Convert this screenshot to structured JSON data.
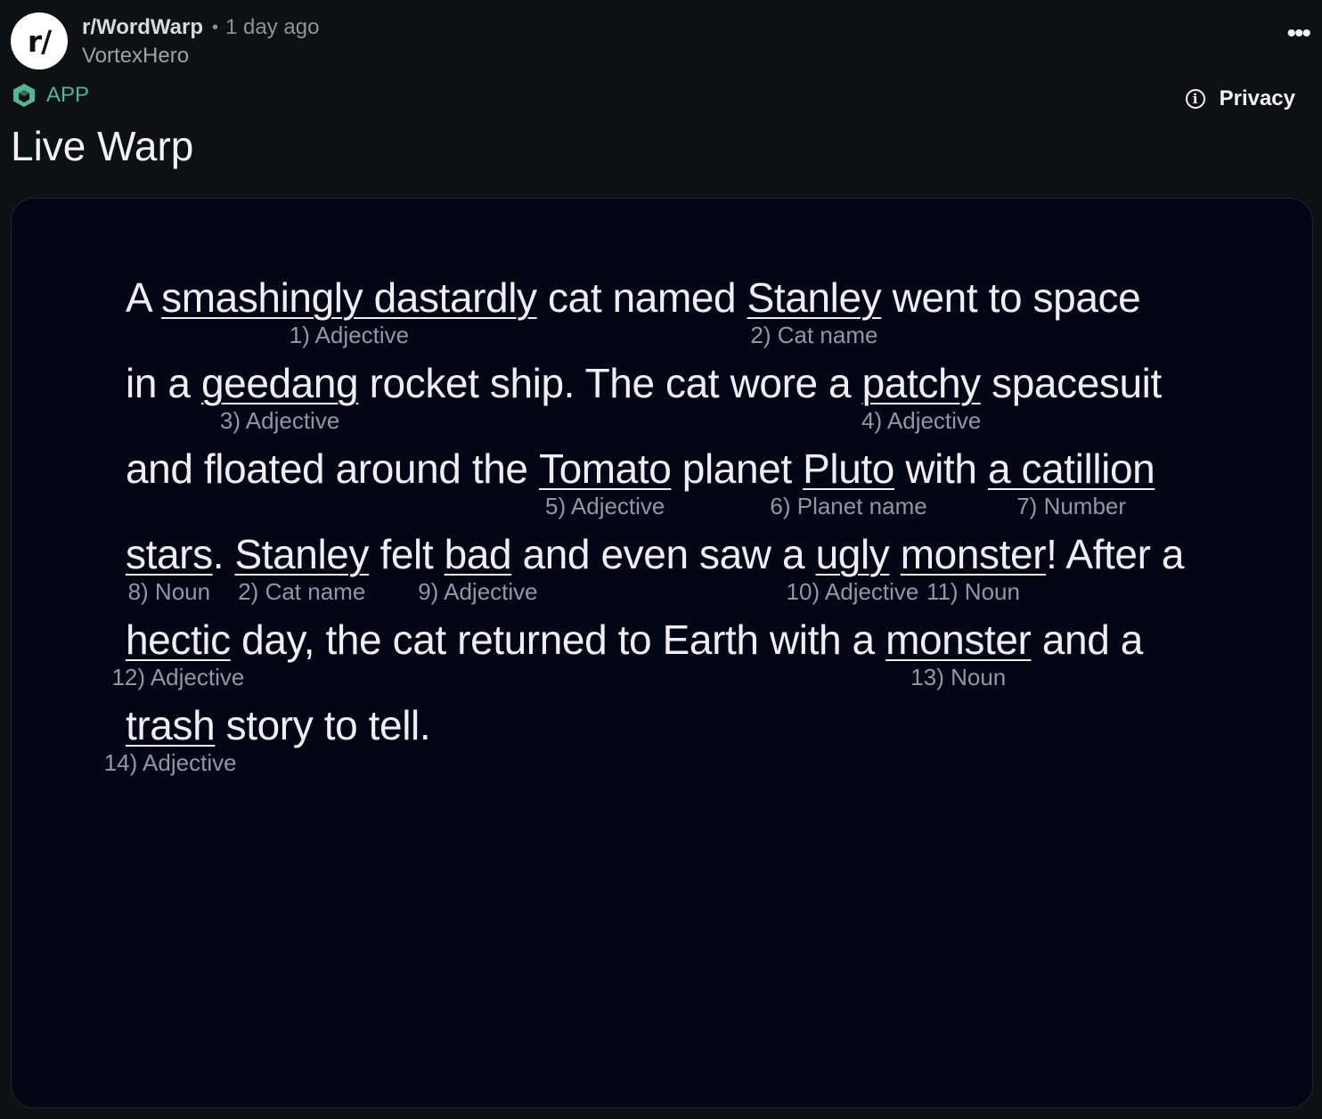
{
  "header": {
    "avatar_label": "r/",
    "subreddit": "r/WordWarp",
    "separator": "•",
    "time": "1 day ago",
    "author": "VortexHero",
    "more_label": "•••"
  },
  "app_badge": {
    "icon": "cube-icon",
    "label": "APP",
    "color": "#53b795"
  },
  "privacy": {
    "icon": "info-icon",
    "icon_glyph": "i",
    "label": "Privacy"
  },
  "post": {
    "title": "Live Warp"
  },
  "story": {
    "lines": [
      [
        {
          "text": "A "
        },
        {
          "word": "smashingly dastardly",
          "hint": "1) Adjective"
        },
        {
          "text": " cat named "
        },
        {
          "word": "Stanley",
          "hint": "2) Cat name"
        },
        {
          "text": " went to space"
        }
      ],
      [
        {
          "text": "in a "
        },
        {
          "word": "geedang",
          "hint": "3) Adjective"
        },
        {
          "text": " rocket ship. The cat wore a "
        },
        {
          "word": "patchy",
          "hint": "4) Adjective"
        },
        {
          "text": " spacesuit"
        }
      ],
      [
        {
          "text": "and floated around the "
        },
        {
          "word": "Tomato",
          "hint": "5) Adjective"
        },
        {
          "text": " planet "
        },
        {
          "word": "Pluto",
          "hint": "6) Planet name"
        },
        {
          "text": " with "
        },
        {
          "word": "a catillion",
          "hint": "7) Number"
        }
      ],
      [
        {
          "word": "stars",
          "hint": "8) Noun"
        },
        {
          "text": ". "
        },
        {
          "word": "Stanley",
          "hint": "2) Cat name"
        },
        {
          "text": " felt "
        },
        {
          "word": "bad",
          "hint": "9) Adjective"
        },
        {
          "text": " and even saw a "
        },
        {
          "word": "ugly",
          "hint": "10) Adjective"
        },
        {
          "text": " "
        },
        {
          "word": "monster",
          "hint": "11) Noun"
        },
        {
          "text": "! After a"
        }
      ],
      [
        {
          "word": "hectic",
          "hint": "12) Adjective"
        },
        {
          "text": " day, the cat returned to Earth with a "
        },
        {
          "word": "monster",
          "hint": "13) Noun"
        },
        {
          "text": " and a"
        }
      ],
      [
        {
          "word": "trash",
          "hint": "14) Adjective"
        },
        {
          "text": " story to tell."
        }
      ]
    ]
  }
}
